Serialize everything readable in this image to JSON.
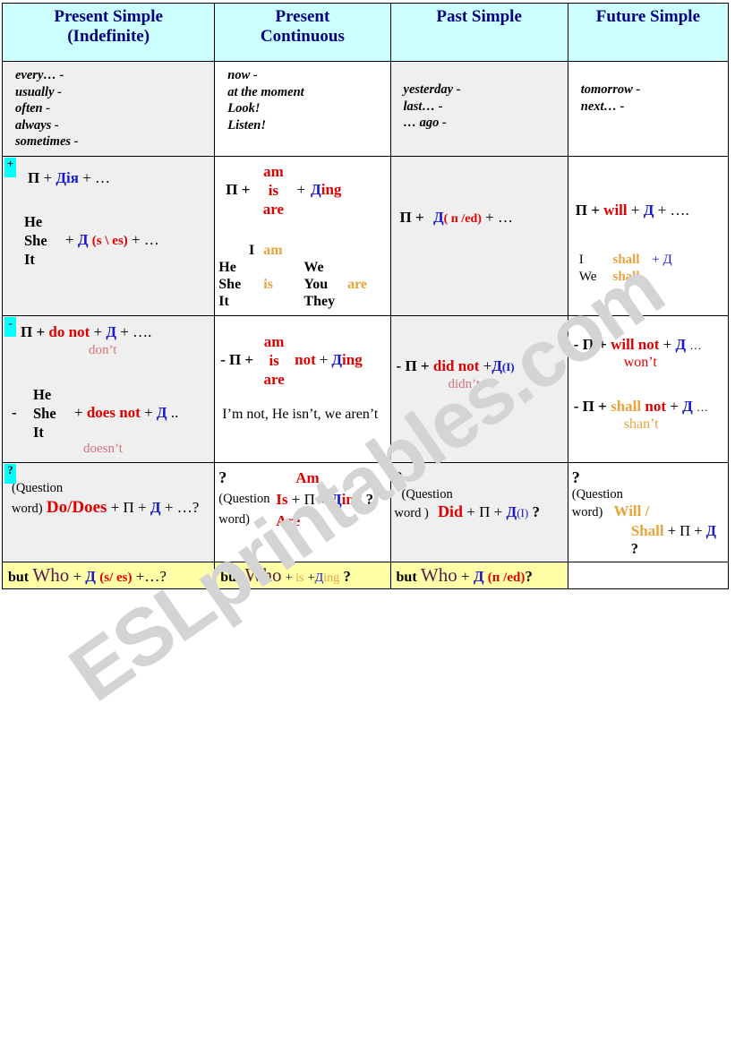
{
  "watermark": {
    "text": "ESLprintables.com"
  },
  "table": {
    "headers": [
      {
        "line1": "Present Simple",
        "line2": "(Indefinite)"
      },
      {
        "line1": "Present",
        "line2": "Continuous"
      },
      {
        "line1": "Past Simple",
        "line2": ""
      },
      {
        "line1": "Future Simple",
        "line2": ""
      }
    ],
    "markers": {
      "affirmative": "+",
      "negative": "-",
      "question": "?"
    },
    "adverbs": {
      "present_simple": [
        "every…  -",
        "usually   -",
        "often      -",
        "always    -",
        "sometimes -"
      ],
      "present_continuous": [
        "now        -",
        "at the moment",
        "Look!",
        "Listen!"
      ],
      "past_simple": [
        "yesterday -",
        "last…       -",
        "… ago      -"
      ],
      "future_simple": [
        "tomorrow -",
        "next… -"
      ]
    },
    "affirmative": {
      "present_simple": {
        "formula_subject": "П",
        "formula_plus1": "+",
        "formula_verb": "Дія",
        "formula_plus2": "+ …",
        "pronouns": [
          "He",
          "She",
          "It"
        ],
        "plus": "+",
        "verb": "Д",
        "ending": "(s \\ es)",
        "tail": "+ …"
      },
      "present_continuous": {
        "subject": "П +",
        "aux_stack": [
          "am",
          "is",
          "are"
        ],
        "plus": "+",
        "verb": "Д",
        "ing": "ing",
        "pron_rows": [
          {
            "a": "I",
            "b": "am",
            "c": "",
            "d": ""
          },
          {
            "a": "He",
            "b": "",
            "c": "We",
            "d": ""
          },
          {
            "a": "She",
            "b": "is",
            "c": "You",
            "d": "are"
          },
          {
            "a": "It",
            "b": "",
            "c": "They",
            "d": ""
          }
        ]
      },
      "past_simple": {
        "subject": "П +",
        "verb": "Д",
        "ending": "( п /ed)",
        "tail": "+ …"
      },
      "future_simple": {
        "subject": "П +",
        "aux": "will",
        "verb": "Д",
        "tail": "+ ….",
        "shall_rows": [
          {
            "pron": "I",
            "aux": "shall",
            "tail": "+ Д"
          },
          {
            "pron": "We",
            "aux": "shall",
            "tail": ""
          }
        ]
      }
    },
    "negative": {
      "present_simple": {
        "line1": {
          "subject": "П +",
          "aux": "do not",
          "plus": "+",
          "verb": "Д",
          "tail": "+ …."
        },
        "short1": "don’t",
        "pronouns": [
          "He",
          "She",
          "It"
        ],
        "dash": "-",
        "aux2": "does not",
        "verb2": "Д",
        "tail2": "..",
        "short2": "doesn’t"
      },
      "present_continuous": {
        "dash": "-",
        "subject": "П +",
        "aux_stack": [
          "am",
          "is",
          "are"
        ],
        "not": "not",
        "plus": "+",
        "verb": "Д",
        "ing": "ing",
        "shorts": "I’m not, He isn’t, we aren’t"
      },
      "past_simple": {
        "dash": "-",
        "subject": "П +",
        "aux": "did not",
        "plus": "+",
        "verb": "Д",
        "ending": "(I)",
        "short": "didn’t"
      },
      "future_simple": {
        "row1": {
          "dash": "-",
          "subject": "П +",
          "aux": "will not",
          "plus": "+",
          "verb": "Д",
          "tail": "…"
        },
        "short1": "won’t",
        "row2": {
          "dash": "-",
          "subject": "П +",
          "aux1": "shall",
          "aux2": "not",
          "plus": "+",
          "verb": "Д",
          "tail": "…"
        },
        "short2": "shan’t"
      }
    },
    "question": {
      "present_simple": {
        "qmark": "?",
        "qword1": "(Question",
        "qword2": "word)",
        "aux": "Do/Does",
        "rest": "+ П + ",
        "verb": "Д",
        "tail": "+ …?"
      },
      "present_continuous": {
        "qmark": "?",
        "qword1": "(Question",
        "qword2": "word)",
        "aux_stack": [
          "Am",
          "Is",
          "Are"
        ],
        "mid": "+ П + ",
        "verb": "Д",
        "ing": "ing",
        "tail": "?"
      },
      "past_simple": {
        "qmark": "?",
        "qword1": "(Question",
        "qword2": "word )",
        "aux": "Did",
        "mid": "+ П + ",
        "verb": "Д",
        "ending": "(I)",
        "tail": "?"
      },
      "future_simple": {
        "qmark": "?",
        "qword1": "(Question",
        "qword2": "word)",
        "aux1": "Will /",
        "aux2": "Shall",
        "mid": "+  П + ",
        "verb": "Д",
        "tail": "?"
      }
    },
    "but_row": {
      "present_simple": {
        "but": "but",
        "who": "Who",
        "plus": "+ ",
        "verb": "Д",
        "ending": "(s/ es)",
        "tail": "+…?"
      },
      "present_continuous": {
        "but": "but",
        "who": "Who",
        "plus": "+ ",
        "aux": "is",
        "plus2": "+",
        "verb": "Д",
        "ing": "ing",
        "tail": "?"
      },
      "past_simple": {
        "but": "but",
        "who": "Who",
        "plus": "+ ",
        "verb": "Д",
        "ending": "(п /ed)",
        "tail": "?"
      },
      "future_simple": {
        "but": "",
        "who": "",
        "plus": "",
        "verb": "",
        "ending": "",
        "tail": ""
      }
    }
  },
  "colors": {
    "header_bg": "#ccffff",
    "header_text": "#000080",
    "shade_bg": "#efefef",
    "yellow_bg": "#ffffa8",
    "red": "#e00000",
    "blue": "#1a1acc",
    "orange": "#e8a33d",
    "pink": "#d9737a",
    "green": "#157a3a",
    "who": "#5b1a4a",
    "marker_bg": "#00ffff"
  }
}
